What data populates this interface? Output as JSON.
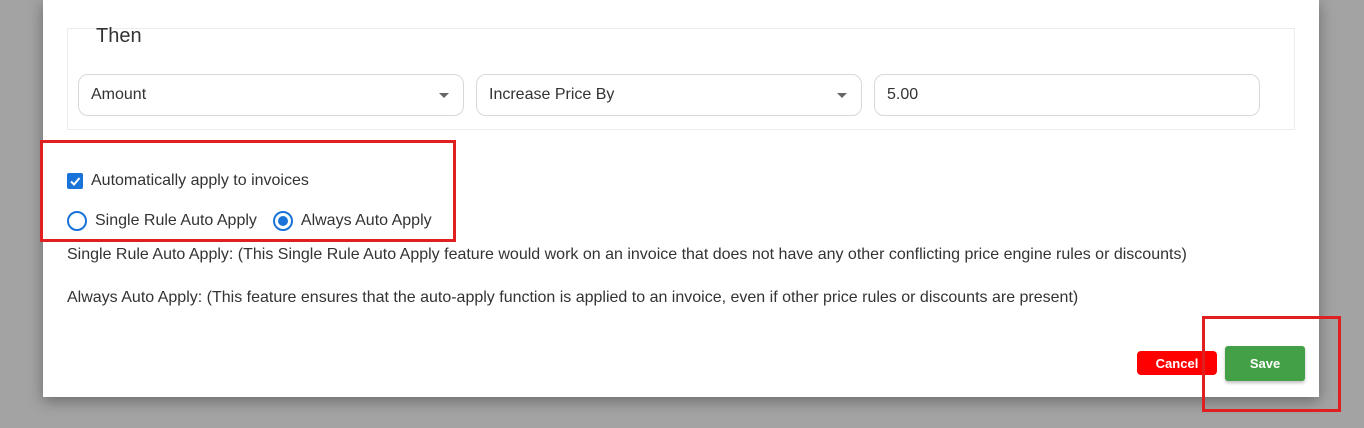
{
  "modal": {
    "section_title": "Then",
    "fields": {
      "amount_type": "Amount",
      "operation": "Increase Price By",
      "value": "5.00"
    },
    "auto_apply": {
      "checkbox_label": "Automatically apply to invoices",
      "checked": true,
      "radio_single_label": "Single Rule Auto Apply",
      "radio_always_label": "Always Auto Apply",
      "selected": "Always Auto Apply"
    },
    "descriptions": {
      "single": "Single Rule Auto Apply: (This Single Rule Auto Apply feature would work on an invoice that does not have any other conflicting price engine rules or discounts)",
      "always": "Always Auto Apply: (This feature ensures that the auto-apply function is applied to an invoice, even if other price rules or discounts are present)"
    },
    "buttons": {
      "cancel": "Cancel",
      "save": "Save"
    }
  },
  "colors": {
    "primary_blue": "#1a73d9",
    "cancel_red": "#ff0000",
    "save_green": "#43a047",
    "highlight_red": "#e02020"
  }
}
